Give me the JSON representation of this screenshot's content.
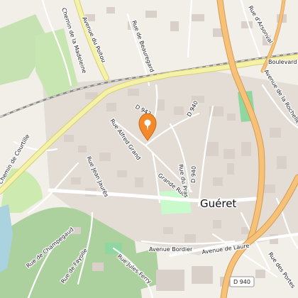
{
  "city": "Guéret",
  "streets": {
    "chemin_madeleine": "Chemin de la Madeleine",
    "avenue_poitou": "Avenue du Poitou",
    "rue_beauregard": "Rue de Beauregard",
    "rue_arsonval": "Rue d'Arsonval",
    "boulevard": "Boulevard",
    "avenue_rochelle": "Avenue de la Rochelle",
    "d942": "D 942",
    "d940_north": "D 940",
    "rue_alfred_grand": "Rue Alfred Grand",
    "rue_jean_jaures": "Rue Jean Jaurès",
    "chemin_courtille": "Chemin de Courtille",
    "grande_rue": "Grande Rue",
    "rue_du_pras": "Rue du Pras",
    "d940_vertical": "D 940",
    "rue_champegaud": "Rue de Champegaud",
    "rue_fayolle": "Rue de Fayolle",
    "rue_jules_ferry": "Rue Jules Ferry",
    "avenue_bordier": "Avenue Bordier",
    "avenue_laure": "Avenue de Laure",
    "d940_south": "D 940",
    "rue_portes": "Rue des Portes"
  },
  "marker": {
    "icon": "location-pin-icon",
    "color": "#f28a2b"
  },
  "colors": {
    "background": "#f2efe9",
    "building": "#d9d0c9",
    "road_major": "#f4f1a8",
    "road_motorway": "#f6c27a",
    "water": "#aad3df",
    "forest": "#add19e",
    "park": "#c8facc",
    "railway": "#888888"
  }
}
